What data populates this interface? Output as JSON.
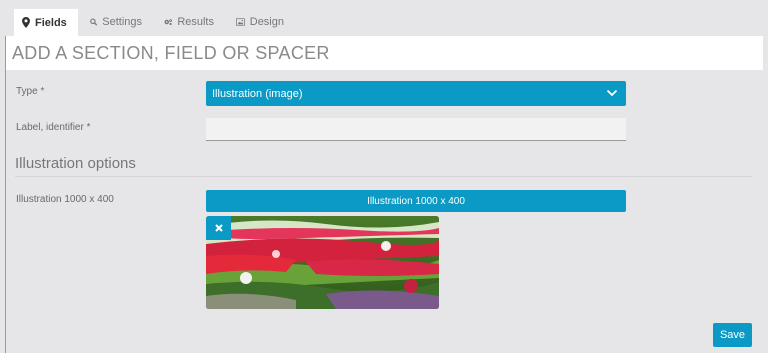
{
  "tabs": [
    {
      "label": "Fields",
      "icon": "map-marker-icon",
      "active": true
    },
    {
      "label": "Settings",
      "icon": "search-icon",
      "active": false
    },
    {
      "label": "Results",
      "icon": "cogs-icon",
      "active": false
    },
    {
      "label": "Design",
      "icon": "picture-icon",
      "active": false
    }
  ],
  "header": {
    "title": "ADD A SECTION, FIELD OR SPACER"
  },
  "form": {
    "type_label": "Type *",
    "type_value": "Illustration (image)",
    "label_identifier_label": "Label, identifier *",
    "label_identifier_value": ""
  },
  "illustration": {
    "section_title": "Illustration options",
    "field_label": "Illustration 1000 x 400",
    "upload_button": "Illustration 1000 x 400",
    "remove_icon": "close-icon"
  },
  "actions": {
    "save_label": "Save"
  },
  "colors": {
    "accent": "#0a9ac5",
    "background": "#e6e6e9"
  }
}
